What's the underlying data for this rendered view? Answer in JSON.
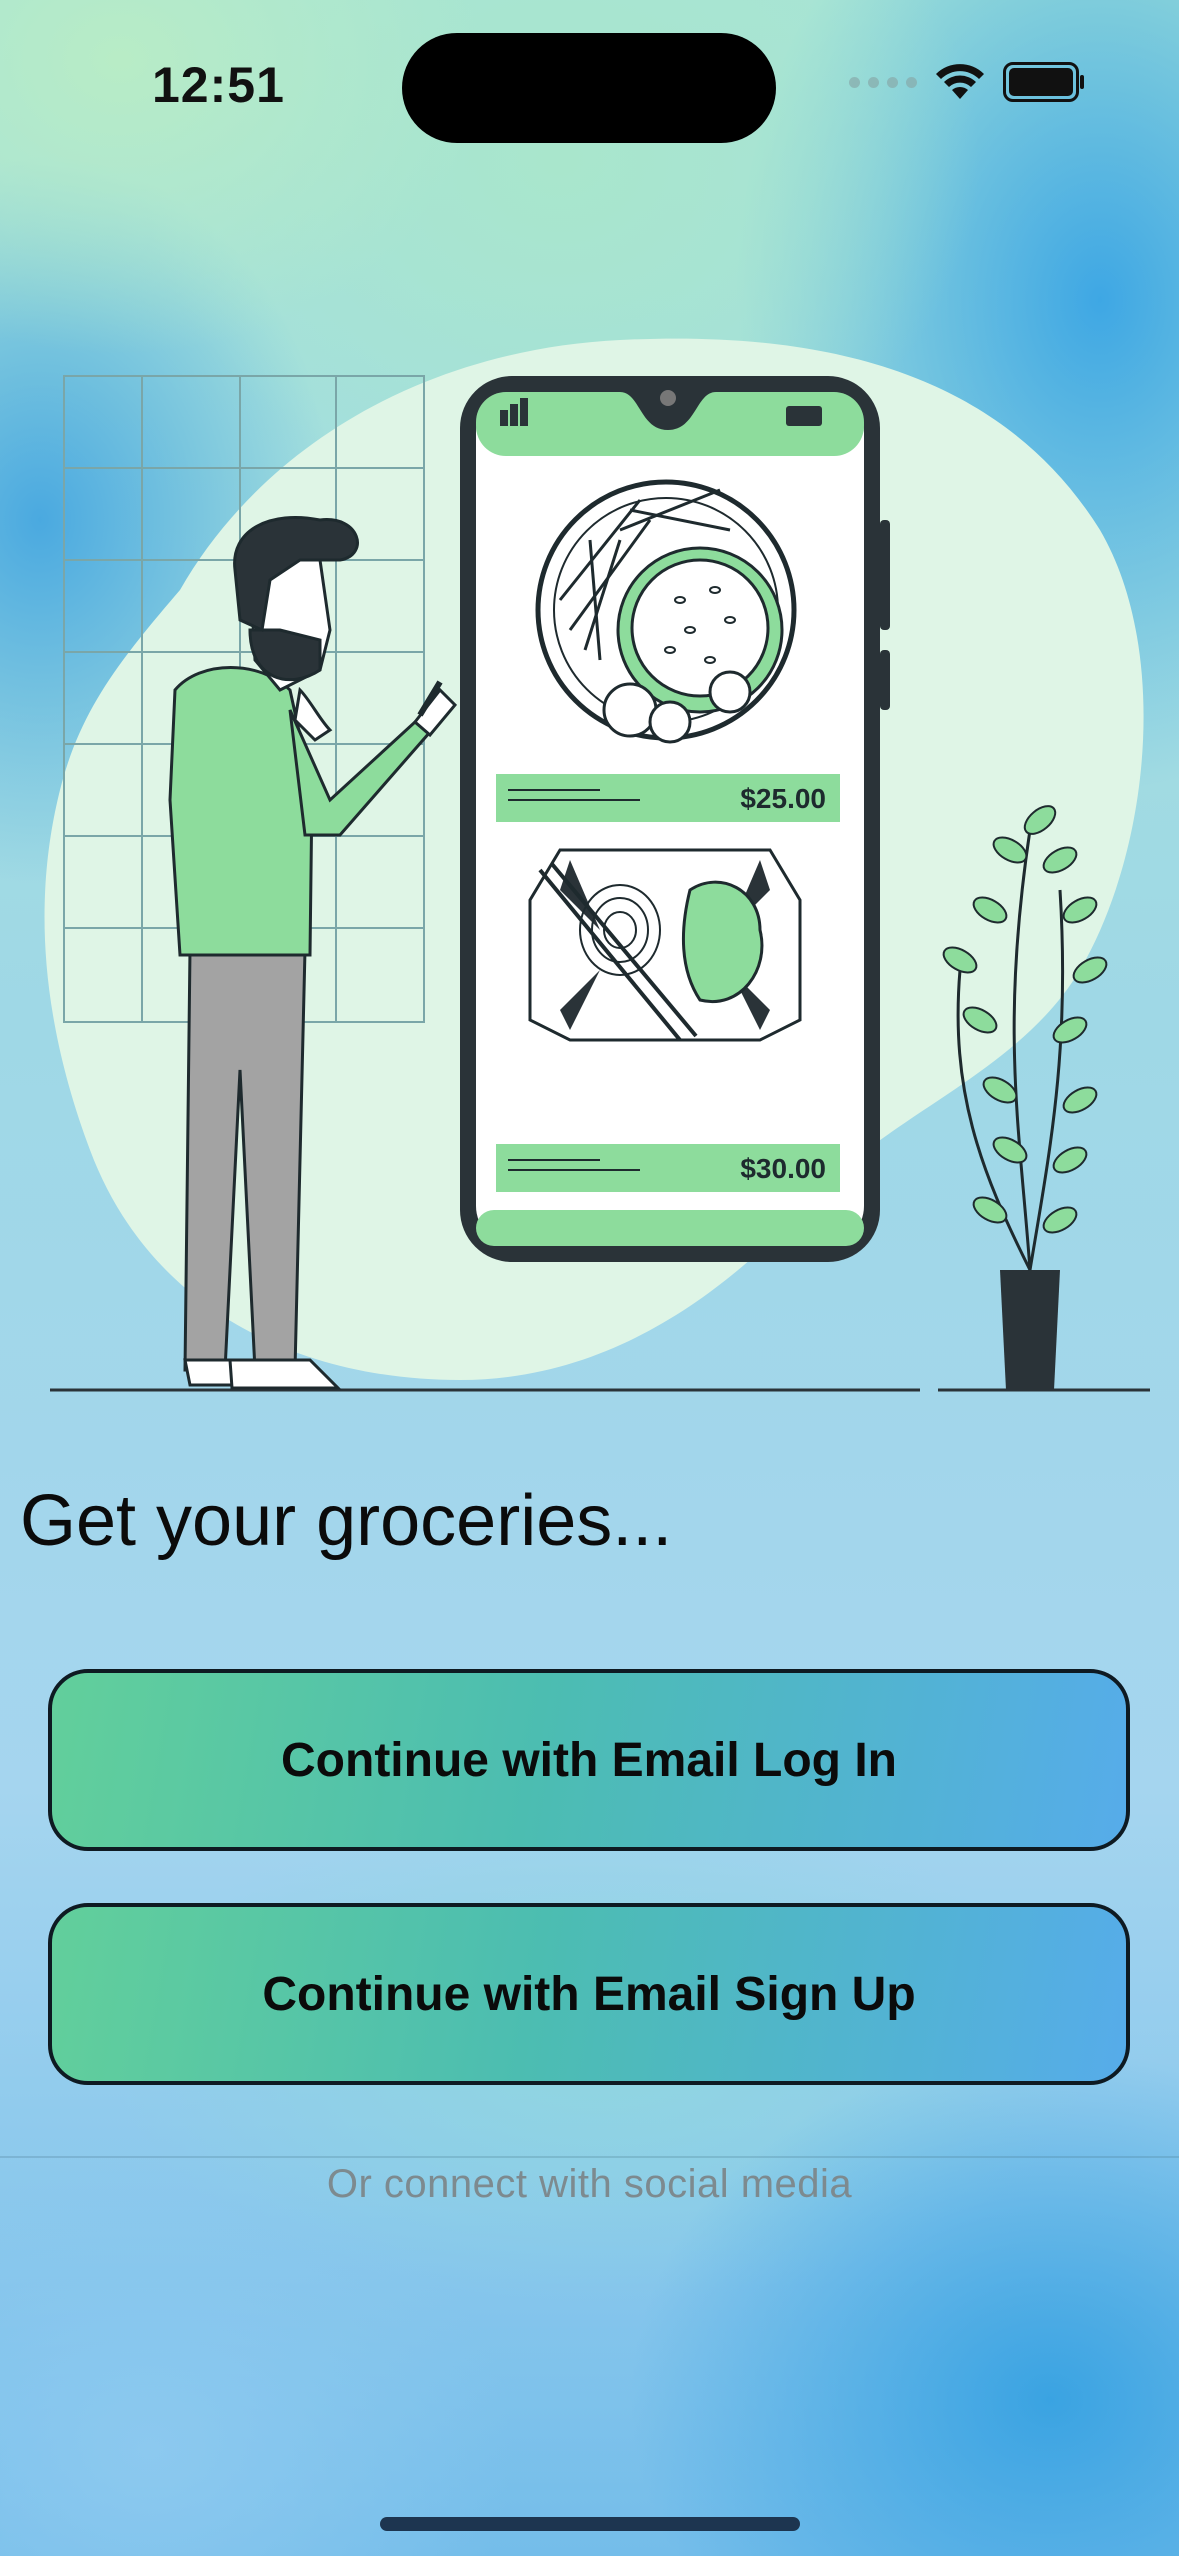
{
  "status_bar": {
    "time": "12:51"
  },
  "illustration": {
    "price_1": "$25.00",
    "price_2": "$30.00"
  },
  "main": {
    "headline": "Get your groceries...",
    "login_button": "Continue with Email Log In",
    "signup_button": "Continue with Email Sign Up",
    "social_text": "Or connect with social media"
  },
  "colors": {
    "accent_green": "#62cf9b",
    "accent_blue": "#56acea",
    "text_dark": "#0b0b0b",
    "muted_text": "#7d8a8f"
  }
}
